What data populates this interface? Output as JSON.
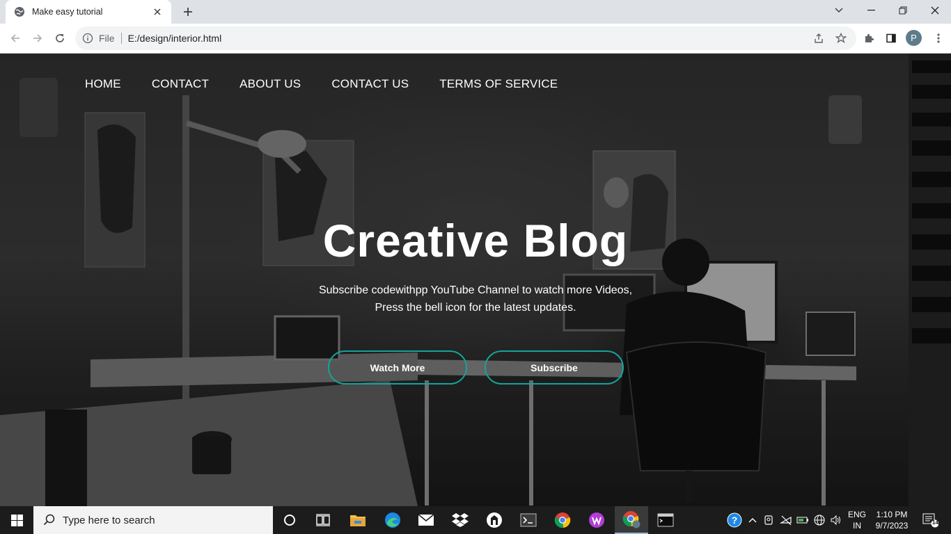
{
  "browser": {
    "tab_title": "Make easy tutorial",
    "scheme_label": "File",
    "url": "E:/design/interior.html",
    "profile_initial": "P"
  },
  "site": {
    "nav": [
      "HOME",
      "CONTACT",
      "ABOUT US",
      "CONTACT US",
      "TERMS OF SERVICE"
    ],
    "hero_title": "Creative Blog",
    "hero_line1": "Subscribe codewithpp YouTube Channel to watch more Videos,",
    "hero_line2": "Press the bell icon for the latest updates.",
    "watch_more_label": "Watch More",
    "subscribe_label": "Subscribe",
    "accent_color": "#15a39a"
  },
  "taskbar": {
    "search_placeholder": "Type here to search",
    "apps": [
      "cortana-icon",
      "task-view-icon",
      "file-explorer-icon",
      "edge-icon",
      "mail-icon",
      "dropbox-icon",
      "app-icon",
      "terminal-icon",
      "chrome-icon",
      "wps-icon",
      "chrome-profile-icon",
      "cmd-icon"
    ],
    "lang_line1": "ENG",
    "lang_line2": "IN",
    "time": "1:10 PM",
    "date": "9/7/2023",
    "notification_count": "14"
  }
}
